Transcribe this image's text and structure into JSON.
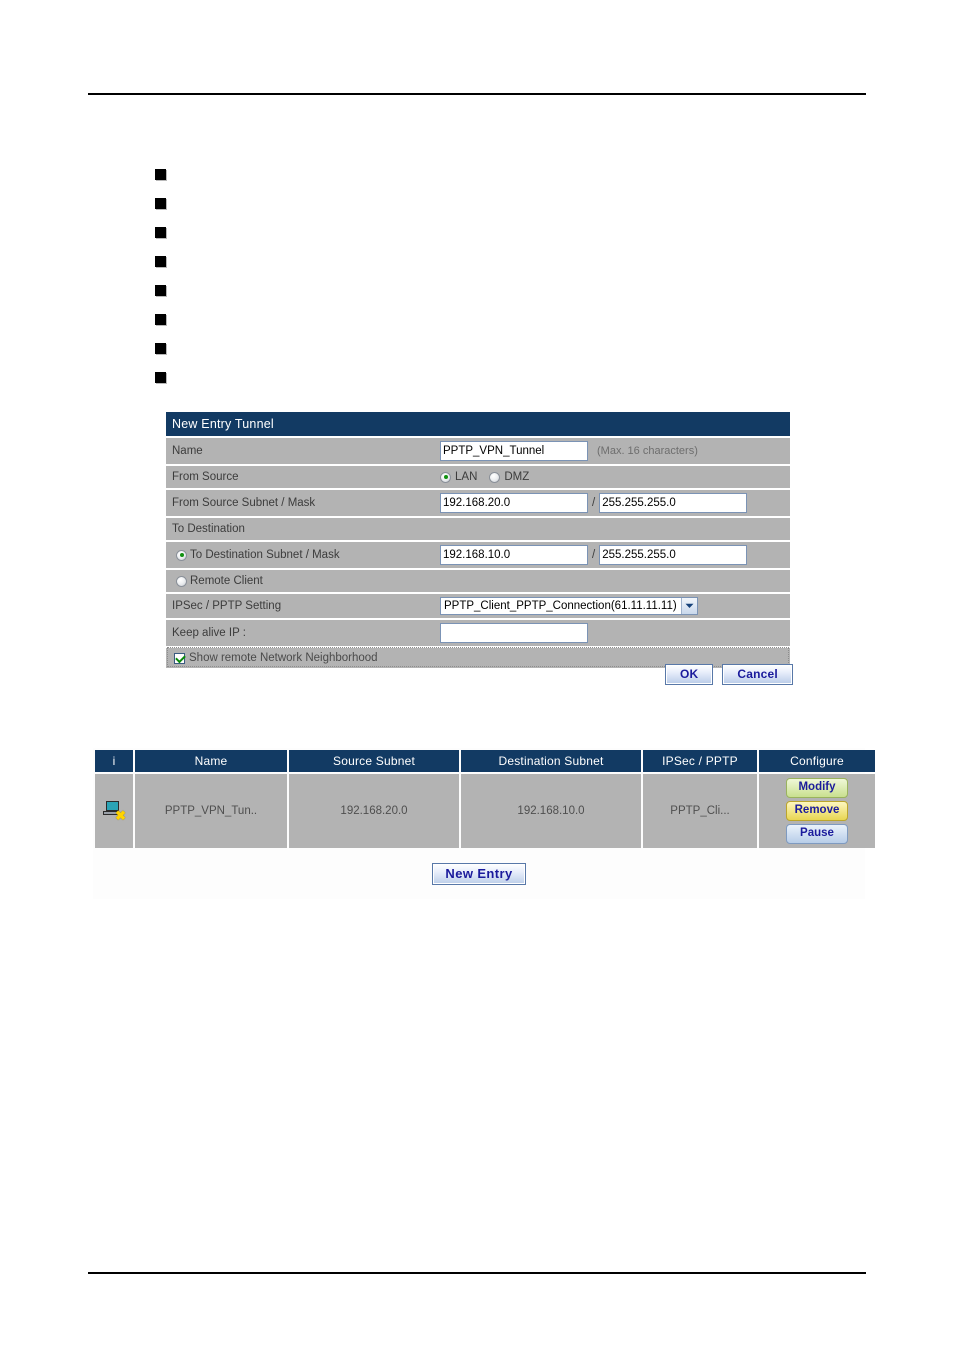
{
  "bullets": [
    {
      "marker": "square",
      "text": ""
    },
    {
      "marker": "square",
      "text": ""
    },
    {
      "marker": "square",
      "text": ""
    },
    {
      "marker": "square",
      "text": ""
    },
    {
      "marker": "square",
      "text": ""
    },
    {
      "marker": "square",
      "text": ""
    },
    {
      "marker": "square",
      "text": ""
    },
    {
      "marker": "square",
      "text": ""
    }
  ],
  "colors": {
    "header_navy": "#123a63",
    "row_gray": "#b3b3b3",
    "radio_green": "#119111",
    "check_green": "#0a8a0a",
    "button_text_blue": "#1b1b9c",
    "modify_green": "#c9e08f",
    "remove_yellow": "#e8d652",
    "pause_blue": "#b7cde8",
    "icon_x_yellow": "#ffd400"
  },
  "form": {
    "title": "New Entry Tunnel",
    "name_label": "Name",
    "name_value": "PPTP_VPN_Tunnel",
    "name_placeholder": "",
    "name_hint": "(Max. 16 characters)",
    "from_source_label": "From Source",
    "from_source_options": [
      {
        "label": "LAN",
        "selected": true
      },
      {
        "label": "DMZ",
        "selected": false
      }
    ],
    "from_subnet_label": "From Source Subnet / Mask",
    "from_subnet_value": "192.168.20.0",
    "from_mask_value": "255.255.255.0",
    "separator": "/",
    "to_destination_label": "To Destination",
    "to_dest_subnet_label": "To Destination Subnet / Mask",
    "to_dest_subnet_selected": true,
    "to_dest_subnet_value": "192.168.10.0",
    "to_dest_mask_value": "255.255.255.0",
    "remote_client_label": "Remote Client",
    "remote_client_selected": false,
    "ipsec_pptp_label": "IPSec / PPTP Setting",
    "ipsec_pptp_value": "PPTP_Client_PPTP_Connection(61.11.11.11)",
    "keep_alive_label": "Keep alive IP :",
    "keep_alive_value": "",
    "keep_alive_placeholder": "",
    "show_neighborhood_label": "Show remote Network Neighborhood",
    "show_neighborhood_checked": true,
    "ok_label": "OK",
    "cancel_label": "Cancel"
  },
  "table": {
    "headers": [
      "i",
      "Name",
      "Source Subnet",
      "Destination Subnet",
      "IPSec / PPTP",
      "Configure"
    ],
    "rows": [
      {
        "status_icon": "computer-disconnected-icon",
        "name": "PPTP_VPN_Tun..",
        "source_subnet": "192.168.20.0",
        "destination_subnet": "192.168.10.0",
        "ipsec_pptp": "PPTP_Cli...",
        "configure": {
          "modify": "Modify",
          "remove": "Remove",
          "pause": "Pause"
        }
      }
    ],
    "new_entry_label": "New  Entry"
  }
}
